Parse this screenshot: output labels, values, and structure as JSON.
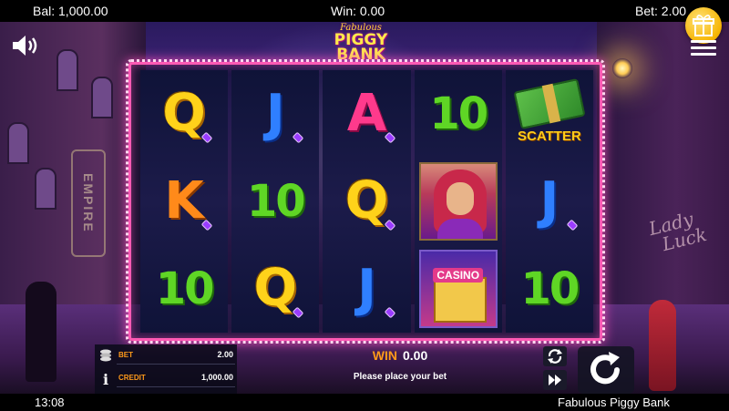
{
  "topbar": {
    "balance": "Bal: 1,000.00",
    "win": "Win: 0.00",
    "bet": "Bet: 2.00"
  },
  "logo": {
    "line1": "Fabulous",
    "line2": "PIGGY",
    "line3": "BANK"
  },
  "scene": {
    "left_sign": "EMPIRE",
    "right_sign_line1": "Lady",
    "right_sign_line2": "Luck"
  },
  "reels": [
    [
      {
        "type": "letter",
        "text": "Q",
        "color_class": "c-q"
      },
      {
        "type": "letter",
        "text": "K",
        "color_class": "c-k"
      },
      {
        "type": "ten",
        "text": "10",
        "color_class": "c-10"
      }
    ],
    [
      {
        "type": "letter",
        "text": "J",
        "color_class": "c-j"
      },
      {
        "type": "ten",
        "text": "10",
        "color_class": "c-10"
      },
      {
        "type": "letter",
        "text": "Q",
        "color_class": "c-q"
      }
    ],
    [
      {
        "type": "letter",
        "text": "A",
        "color_class": "c-a"
      },
      {
        "type": "letter",
        "text": "Q",
        "color_class": "c-q"
      },
      {
        "type": "letter",
        "text": "J",
        "color_class": "c-j"
      }
    ],
    [
      {
        "type": "ten",
        "text": "10",
        "color_class": "c-10"
      },
      {
        "type": "portrait",
        "text": ""
      },
      {
        "type": "casino",
        "text": "CASINO"
      }
    ],
    [
      {
        "type": "scatter",
        "text": "SCATTER"
      },
      {
        "type": "letter",
        "text": "J",
        "color_class": "c-j"
      },
      {
        "type": "ten",
        "text": "10",
        "color_class": "c-10"
      }
    ]
  ],
  "hud": {
    "bet_label": "BET",
    "bet_value": "2.00",
    "credit_label": "CREDIT",
    "credit_value": "1,000.00",
    "win_label": "WIN",
    "win_value": "0.00",
    "message": "Please place your bet"
  },
  "status": {
    "time": "13:08",
    "game_name": "Fabulous Piggy Bank"
  },
  "colors": {
    "frame_accent": "#ff5ab4",
    "label_orange": "#ff9a1a",
    "gift_gold": "#f6b400"
  },
  "icons": [
    "speaker-icon",
    "gift-icon",
    "menu-icon",
    "coins-icon",
    "info-icon",
    "autoplay-icon",
    "turbo-icon",
    "spin-icon"
  ]
}
